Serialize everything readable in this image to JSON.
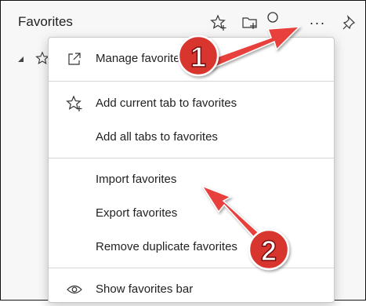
{
  "header": {
    "title": "Favorites",
    "icons": [
      "add-favorite-star-icon",
      "add-folder-icon",
      "search-icon",
      "more-options-icon",
      "pin-icon"
    ],
    "more_label": "···"
  },
  "menu": {
    "items": [
      {
        "label": "Manage favorites",
        "icon": "open-external-icon"
      },
      {
        "label": "Add current tab to favorites",
        "icon": "star-plus-icon"
      },
      {
        "label": "Add all tabs to favorites",
        "icon": ""
      },
      {
        "label": "Import favorites",
        "icon": ""
      },
      {
        "label": "Export favorites",
        "icon": ""
      },
      {
        "label": "Remove duplicate favorites",
        "icon": ""
      },
      {
        "label": "Show favorites bar",
        "icon": "eye-icon"
      }
    ]
  },
  "annotations": [
    {
      "number": "1",
      "color": "#e33b3b"
    },
    {
      "number": "2",
      "color": "#e33b3b"
    }
  ],
  "colors": {
    "arrow": "#e8403e",
    "badge": "#d8352f",
    "badge_outline": "#ffffff"
  }
}
